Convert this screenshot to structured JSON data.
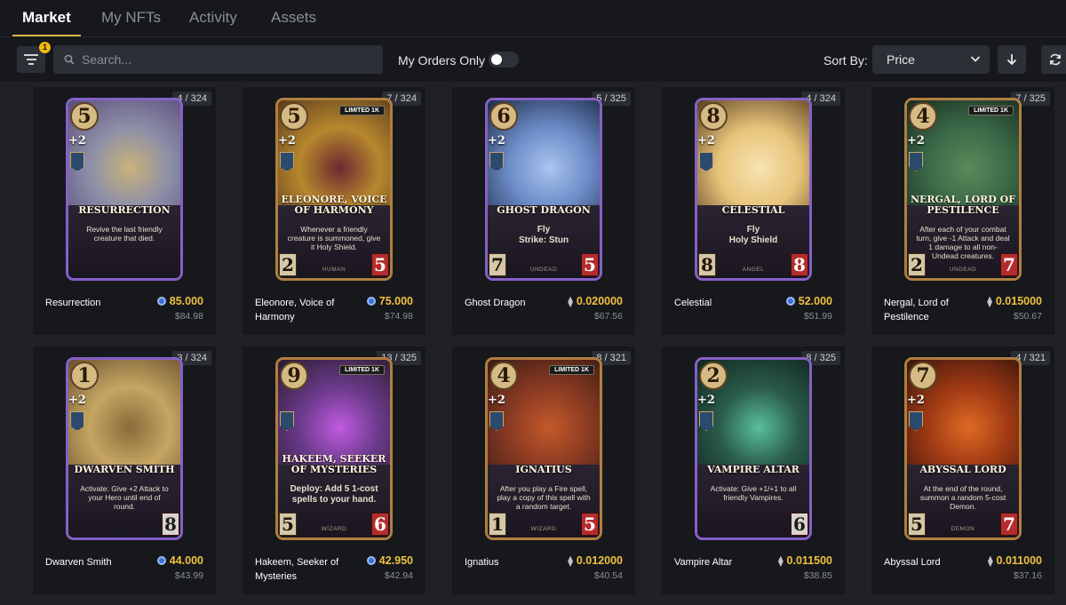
{
  "nav": {
    "tabs": [
      {
        "label": "Market",
        "active": true
      },
      {
        "label": "My NFTs",
        "active": false
      },
      {
        "label": "Activity",
        "active": false
      },
      {
        "label": "Assets",
        "active": false
      }
    ]
  },
  "toolbar": {
    "filter_count": "1",
    "search_placeholder": "Search...",
    "search_value": "",
    "my_orders_label": "My Orders Only",
    "my_orders_on": false,
    "sort_label": "Sort By:",
    "sort_value": "Price",
    "sort_direction": "descending"
  },
  "currency_icons": {
    "gods": "gods-coin-icon",
    "eth": "eth-icon"
  },
  "cards": [
    {
      "name": "Resurrection",
      "card_title": "RESURRECTION",
      "copies": "4 / 324",
      "mana": "5",
      "bonus": "+2",
      "text": "Revive the last friendly creature that died.",
      "race": "",
      "attack": "",
      "health": "",
      "limited": "",
      "price": "85.000",
      "currency": "gods",
      "usd": "$84.98"
    },
    {
      "name": "Eleonore, Voice of Harmony",
      "card_title": "ELEONORE, VOICE OF HARMONY",
      "copies": "7 / 324",
      "mana": "5",
      "bonus": "+2",
      "text": "Whenever a friendly creature is summoned, give it Holy Shield.",
      "race": "HUMAN",
      "attack": "2",
      "health": "5",
      "limited": "LIMITED 1K",
      "price": "75.000",
      "currency": "gods",
      "usd": "$74.98"
    },
    {
      "name": "Ghost Dragon",
      "card_title": "GHOST DRAGON",
      "copies": "5 / 325",
      "mana": "6",
      "bonus": "+2",
      "text": "Fly\nStrike: Stun",
      "race": "UNDEAD",
      "attack": "7",
      "health": "5",
      "limited": "",
      "price": "0.020000",
      "currency": "eth",
      "usd": "$67.56"
    },
    {
      "name": "Celestial",
      "card_title": "CELESTIAL",
      "copies": "4 / 324",
      "mana": "8",
      "bonus": "+2",
      "text": "Fly\nHoly Shield",
      "race": "ANGEL",
      "attack": "8",
      "health": "8",
      "limited": "",
      "price": "52.000",
      "currency": "gods",
      "usd": "$51.99"
    },
    {
      "name": "Nergal, Lord of Pestilence",
      "card_title": "NERGAL, LORD OF PESTILENCE",
      "copies": "7 / 325",
      "mana": "4",
      "bonus": "+2",
      "text": "After each of your combat turn, give -1 Attack and deal 1 damage to all non-Undead creatures.",
      "race": "UNDEAD",
      "attack": "2",
      "health": "7",
      "limited": "LIMITED 1K",
      "price": "0.015000",
      "currency": "eth",
      "usd": "$50.67"
    },
    {
      "name": "Dwarven Smith",
      "card_title": "DWARVEN SMITH",
      "copies": "3 / 324",
      "mana": "1",
      "bonus": "+2",
      "text": "Activate: Give +2 Attack to your Hero until end of round.",
      "race": "",
      "attack": "",
      "health": "8",
      "limited": "",
      "price": "44.000",
      "currency": "gods",
      "usd": "$43.99"
    },
    {
      "name": "Hakeem, Seeker of Mysteries",
      "card_title": "HAKEEM, SEEKER OF MYSTERIES",
      "copies": "13 / 325",
      "mana": "9",
      "bonus": "",
      "text": "Deploy: Add 5 1-cost spells to your hand.",
      "race": "WIZARD",
      "attack": "5",
      "health": "6",
      "limited": "LIMITED 1K",
      "price": "42.950",
      "currency": "gods",
      "usd": "$42.94"
    },
    {
      "name": "Ignatius",
      "card_title": "IGNATIUS",
      "copies": "8 / 321",
      "mana": "4",
      "bonus": "+2",
      "text": "After you play a Fire spell, play a copy of this spell with a random target.",
      "race": "WIZARD",
      "attack": "1",
      "health": "5",
      "limited": "LIMITED 1K",
      "price": "0.012000",
      "currency": "eth",
      "usd": "$40.54"
    },
    {
      "name": "Vampire Altar",
      "card_title": "VAMPIRE ALTAR",
      "copies": "8 / 325",
      "mana": "2",
      "bonus": "+2",
      "text": "Activate: Give +1/+1 to all friendly Vampires.",
      "race": "",
      "attack": "",
      "health": "6",
      "limited": "",
      "price": "0.011500",
      "currency": "eth",
      "usd": "$38.85"
    },
    {
      "name": "Abyssal Lord",
      "card_title": "ABYSSAL LORD",
      "copies": "4 / 321",
      "mana": "7",
      "bonus": "+2",
      "text": "At the end of the round, summon a random 5-cost Demon.",
      "race": "DEMON",
      "attack": "5",
      "health": "7",
      "limited": "",
      "price": "0.011000",
      "currency": "eth",
      "usd": "$37.16"
    }
  ],
  "card_themes": [
    {
      "frame": "purple",
      "art": [
        "#5a4d7a",
        "#8d8fa8",
        "#c9b27a"
      ]
    },
    {
      "frame": "gold",
      "art": [
        "#5b3a1c",
        "#b7872e",
        "#6a2a30"
      ]
    },
    {
      "frame": "purple",
      "art": [
        "#1e2b46",
        "#6c8cc8",
        "#aac4ee"
      ]
    },
    {
      "frame": "purple",
      "art": [
        "#5a4024",
        "#e8c47a",
        "#f6e3b0"
      ]
    },
    {
      "frame": "gold",
      "art": [
        "#1c2a20",
        "#3a6a48",
        "#5c8a5a"
      ]
    },
    {
      "frame": "purple",
      "art": [
        "#6a5230",
        "#c6a662",
        "#8a6a3a"
      ]
    },
    {
      "frame": "gold",
      "art": [
        "#2a1c2e",
        "#6a3a8a",
        "#c05ae0"
      ]
    },
    {
      "frame": "gold",
      "art": [
        "#3a1c14",
        "#8a3a22",
        "#c45a2a"
      ]
    },
    {
      "frame": "purple",
      "art": [
        "#10241e",
        "#2a5a4c",
        "#58c09a"
      ]
    },
    {
      "frame": "gold",
      "art": [
        "#3a140c",
        "#a03a14",
        "#e06a24"
      ]
    }
  ]
}
